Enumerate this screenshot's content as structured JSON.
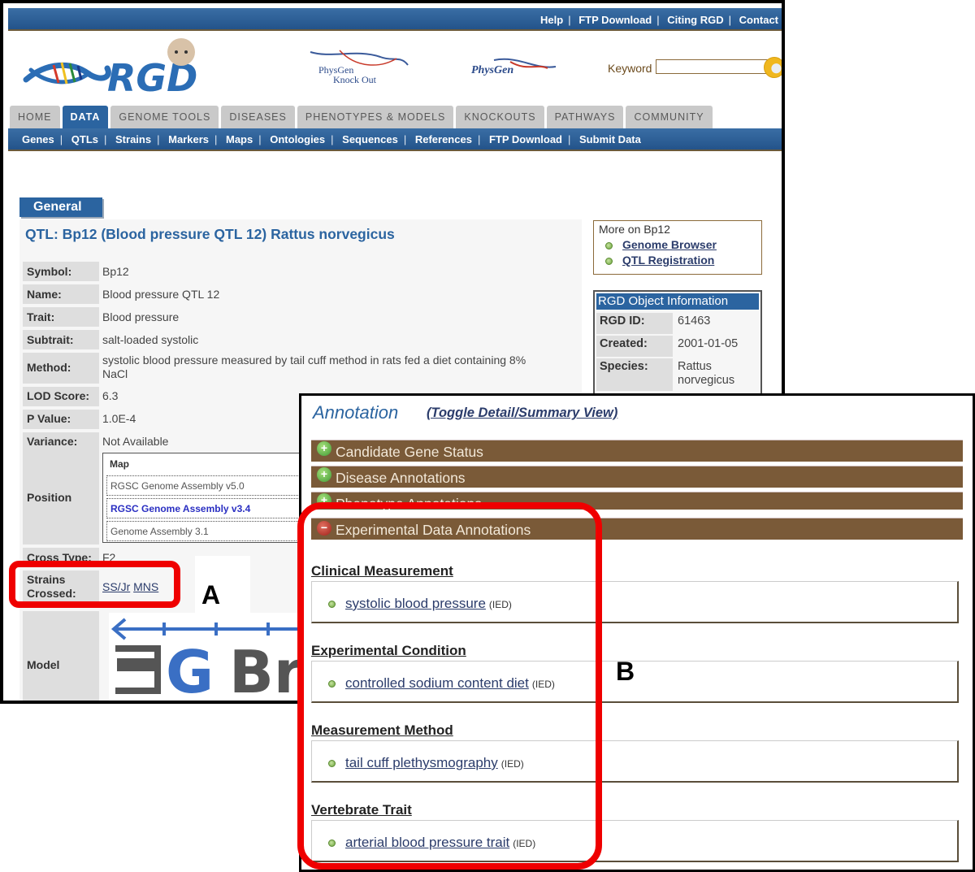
{
  "header": {
    "top_links": [
      "Help",
      "FTP Download",
      "Citing RGD",
      "Contact"
    ],
    "logo_text": "RGD",
    "partner_logos": [
      {
        "name": "physgen-knockout-logo",
        "lines": [
          "PhysGen",
          "Knock Out"
        ]
      },
      {
        "name": "physgen-logo",
        "lines": [
          "PhysGen"
        ]
      }
    ],
    "search": {
      "label": "Keyword",
      "value": "",
      "placeholder": ""
    }
  },
  "nav": {
    "tabs": [
      "HOME",
      "DATA",
      "GENOME TOOLS",
      "DISEASES",
      "PHENOTYPES & MODELS",
      "KNOCKOUTS",
      "PATHWAYS",
      "COMMUNITY"
    ],
    "active_tab": "DATA",
    "subnav": [
      "Genes",
      "QTLs",
      "Strains",
      "Markers",
      "Maps",
      "Ontologies",
      "Sequences",
      "References",
      "FTP Download",
      "Submit Data"
    ]
  },
  "general": {
    "section_tab": "General",
    "title": "QTL: Bp12 (Blood pressure QTL 12) Rattus norvegicus",
    "fields": [
      {
        "label": "Symbol:",
        "value": "Bp12"
      },
      {
        "label": "Name:",
        "value": "Blood pressure QTL 12"
      },
      {
        "label": "Trait:",
        "value": "Blood pressure"
      },
      {
        "label": "Subtrait:",
        "value": "salt-loaded systolic"
      },
      {
        "label": "Method:",
        "value": "systolic blood pressure measured by tail cuff method in rats fed a diet containing 8%",
        "value2": "NaCl"
      },
      {
        "label": "LOD Score:",
        "value": "6.3"
      },
      {
        "label": "P Value:",
        "value": "1.0E-4"
      },
      {
        "label": "Variance:",
        "value": "Not Available"
      }
    ],
    "position": {
      "label": "Position",
      "map_header": "Map",
      "maps": [
        "RGSC Genome Assembly v5.0",
        "RGSC Genome Assembly v3.4",
        "Genome Assembly 3.1"
      ],
      "active_map": "RGSC Genome Assembly v3.4"
    },
    "cross_type": {
      "label": "Cross Type:",
      "value": "F2"
    },
    "strains_crossed": {
      "label_line1": "Strains",
      "label_line2": "Crossed:",
      "strains": [
        "SS/Jr",
        "MNS"
      ]
    },
    "model": {
      "label": "Model",
      "graphic_text": "GBr"
    }
  },
  "more_on": {
    "title": "More on Bp12",
    "links": [
      "Genome Browser",
      "QTL Registration"
    ]
  },
  "rgd_object": {
    "title": "RGD Object Information",
    "fields": [
      {
        "label": "RGD ID:",
        "value": "61463"
      },
      {
        "label": "Created:",
        "value": "2001-01-05"
      },
      {
        "label": "Species:",
        "value": "Rattus",
        "value2": "norvegicus"
      }
    ]
  },
  "annotation": {
    "title": "Annotation",
    "toggle_link": "(Toggle Detail/Summary View)",
    "sections": [
      {
        "label": "Candidate Gene Status",
        "state": "collapsed",
        "icon": "plus-icon"
      },
      {
        "label": "Disease Annotations",
        "state": "collapsed",
        "icon": "plus-icon"
      },
      {
        "label": "Phenotype Annotations",
        "state": "collapsed",
        "icon": "plus-icon"
      },
      {
        "label": "Experimental Data Annotations",
        "state": "expanded",
        "icon": "minus-icon"
      }
    ],
    "categories": [
      {
        "title": "Clinical Measurement",
        "term": "systolic blood pressure",
        "evidence": "(IED)"
      },
      {
        "title": "Experimental Condition",
        "term": "controlled sodium content diet",
        "evidence": "(IED)"
      },
      {
        "title": "Measurement Method",
        "term": "tail cuff plethysmography",
        "evidence": "(IED)"
      },
      {
        "title": "Vertebrate Trait",
        "term": "arterial blood pressure trait",
        "evidence": "(IED)"
      }
    ]
  },
  "callouts": {
    "a": "A",
    "b": "B",
    "highlight_color": "#ef0000"
  },
  "colors": {
    "brand_blue": "#2b64a0",
    "accordion_brown": "#7a5a38",
    "active_map_link": "#2a2fc2"
  }
}
